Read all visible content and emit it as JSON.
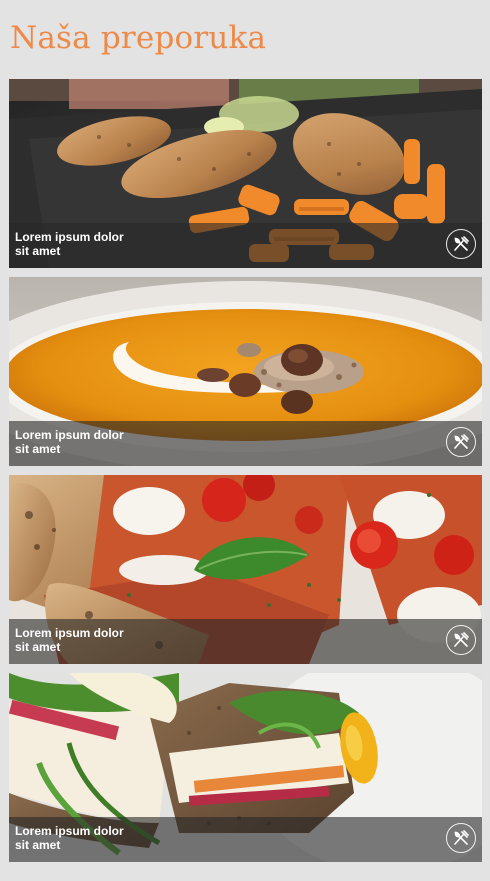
{
  "page": {
    "title": "Naša preporuka",
    "accent_color": "#ee8a49",
    "background_color": "#e3e3e3"
  },
  "cards": [
    {
      "image": "grilled-chicken-with-carrots-photo",
      "text": "Lorem ipsum dolor sit amet",
      "icon": "cutlery-icon"
    },
    {
      "image": "pumpkin-soup-with-hazelnuts-photo",
      "text": "Lorem ipsum dolor sit amet",
      "icon": "cutlery-icon"
    },
    {
      "image": "pizza-with-mozzarella-and-basil-photo",
      "text": "Lorem ipsum dolor sit amet",
      "icon": "cutlery-icon"
    },
    {
      "image": "sandwich-wrap-with-egg-and-greens-photo",
      "text": "Lorem ipsum dolor sit amet",
      "icon": "cutlery-icon"
    }
  ]
}
